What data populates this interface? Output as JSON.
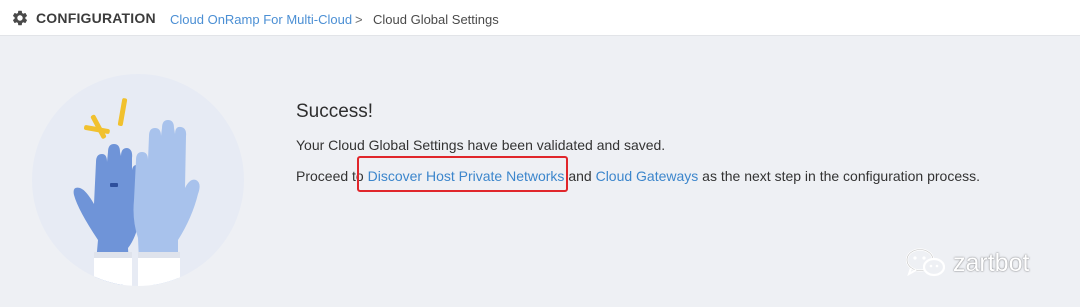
{
  "header": {
    "title": "CONFIGURATION",
    "icon": "gear-icon",
    "breadcrumb": {
      "parent": "Cloud OnRamp For Multi-Cloud",
      "separator": ">",
      "current": "Cloud Global Settings"
    }
  },
  "message": {
    "title": "Success!",
    "line1": "Your Cloud Global Settings have been validated and saved.",
    "line2_prefix": "Proceed to ",
    "link1": "Discover Host Private Networks",
    "line2_middle": " and ",
    "link2": "Cloud Gateways",
    "line2_suffix": " as the next step in the configuration process."
  },
  "watermark": {
    "text": "zartbot",
    "icon": "wechat-logo-icon"
  },
  "colors": {
    "link": "#3c86cc",
    "breadcrumb_link": "#4b8fd4",
    "highlight": "#e0262b",
    "background": "#eef0f4"
  }
}
